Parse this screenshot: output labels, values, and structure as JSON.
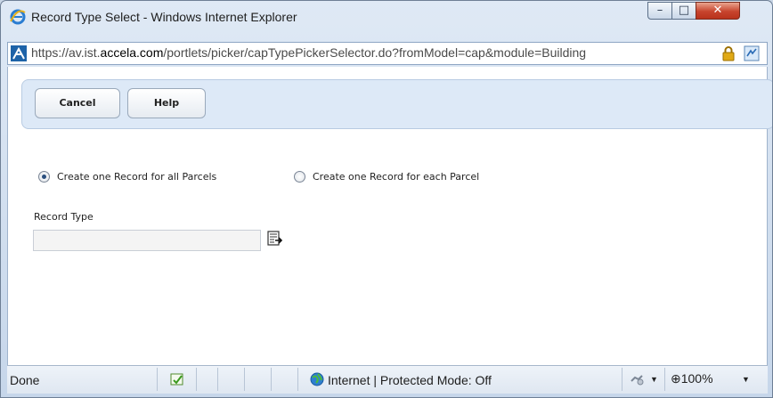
{
  "window": {
    "title": "Record Type Select - Windows Internet Explorer",
    "minimize_glyph": "–",
    "maximize_glyph": "□",
    "close_glyph": "✕"
  },
  "address_bar": {
    "url_prefix": "https://av.ist.",
    "url_domain": "accela.com",
    "url_path": "/portlets/picker/capTypePickerSelector.do?fromModel=cap&module=Building"
  },
  "toolbar": {
    "cancel_label": "Cancel",
    "help_label": "Help"
  },
  "options": {
    "all_parcels_label": "Create one Record for all Parcels",
    "each_parcel_label": "Create one Record for each Parcel",
    "selected": "all_parcels"
  },
  "record_type": {
    "label": "Record Type",
    "value": ""
  },
  "status_bar": {
    "status": "Done",
    "zone": "Internet | Protected Mode: Off",
    "zoom": "100%",
    "zoom_prefix": "⊕",
    "dropdown_glyph": "▼"
  },
  "colors": {
    "strip_background": "#dde9f7",
    "close_button": "#c7442d",
    "accent": "#1e63a8"
  },
  "icons": [
    "ie-logo-icon",
    "site-favicon-icon",
    "lock-icon",
    "compatibility-view-icon",
    "picker-icon",
    "popup-blocker-icon",
    "globe-icon",
    "security-settings-icon",
    "zoom-icon"
  ]
}
